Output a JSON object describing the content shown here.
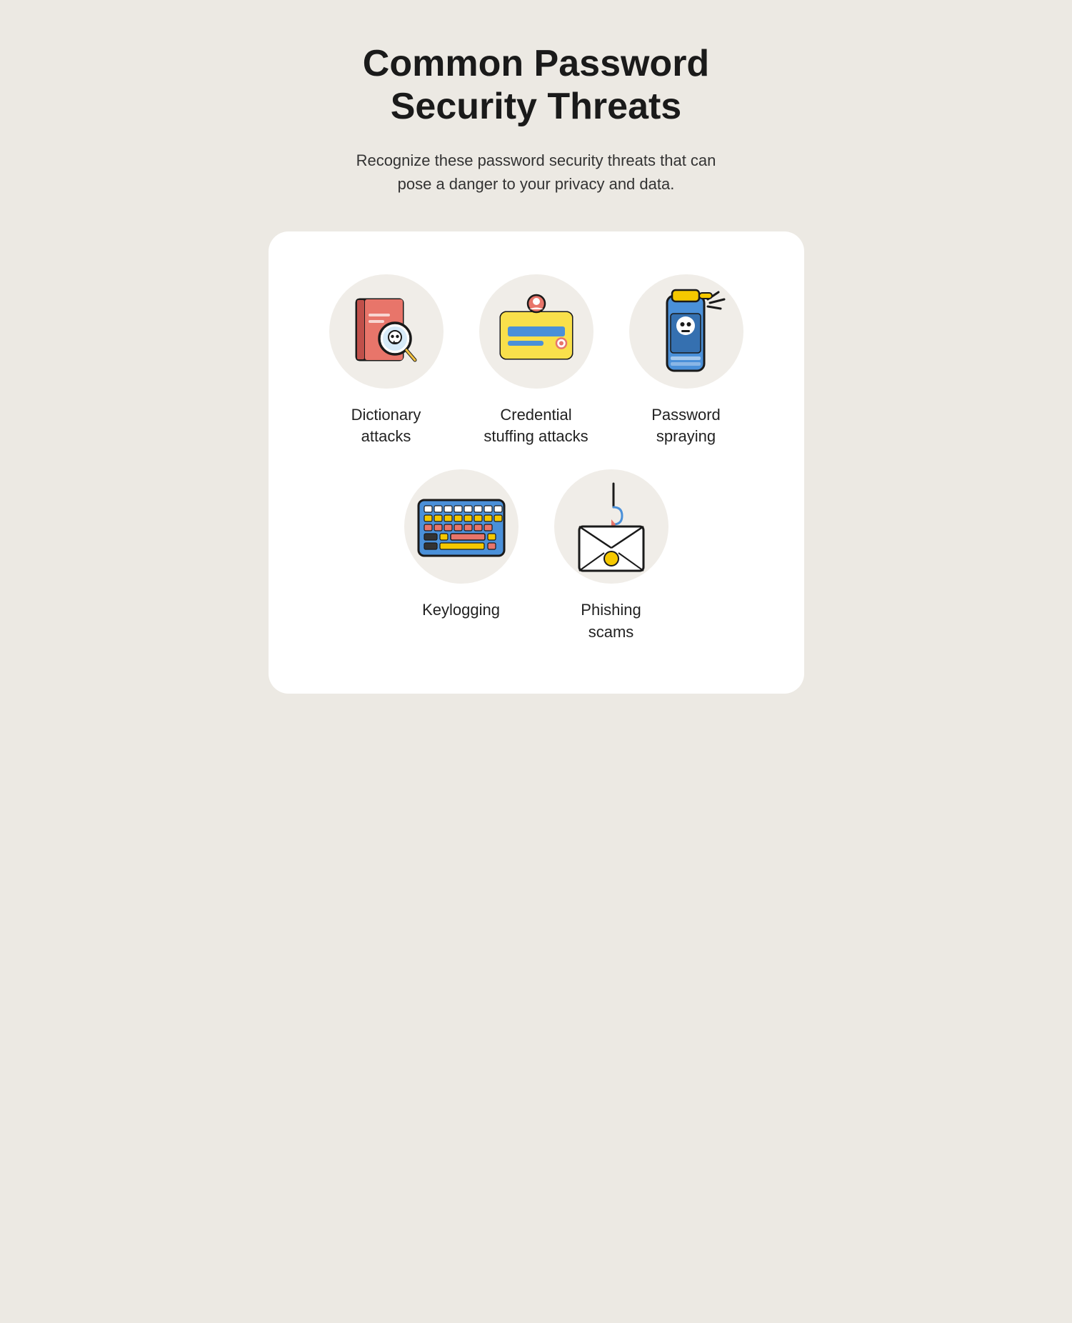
{
  "page": {
    "title": "Common Password\nSecurity Threats",
    "subtitle": "Recognize these password security threats that can pose a danger to your privacy and data.",
    "card": {
      "threats_top": [
        {
          "id": "dictionary-attacks",
          "label": "Dictionary\nattacks"
        },
        {
          "id": "credential-stuffing",
          "label": "Credential\nstuffing attacks"
        },
        {
          "id": "password-spraying",
          "label": "Password\nspraying"
        }
      ],
      "threats_bottom": [
        {
          "id": "keylogging",
          "label": "Keylogging"
        },
        {
          "id": "phishing-scams",
          "label": "Phishing\nscams"
        }
      ]
    }
  }
}
